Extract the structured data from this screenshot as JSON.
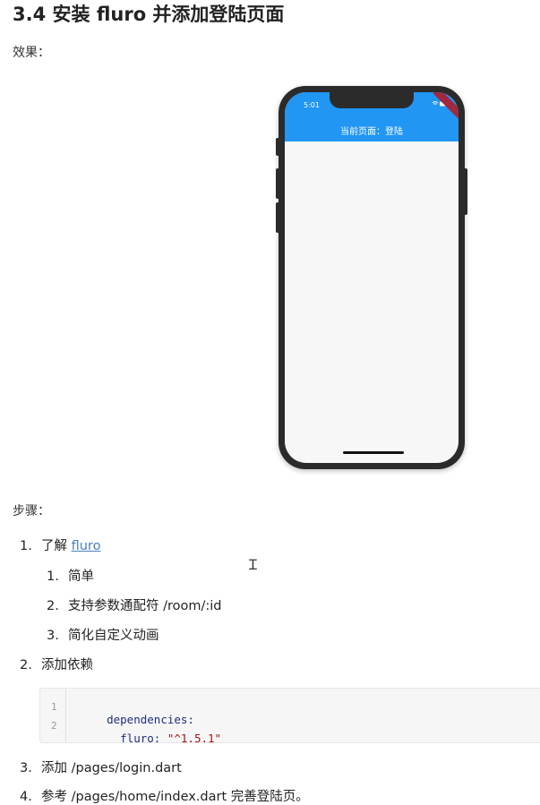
{
  "heading": "3.4 安装 fluro 并添加登陆页面",
  "effect_label": "效果：",
  "phone": {
    "status_time": "5:01",
    "appbar_title": "当前页面：登陆"
  },
  "steps_label": "步骤：",
  "steps": [
    {
      "num": "1.",
      "text": "了解 ",
      "link": "fluro",
      "sub": [
        {
          "num": "1.",
          "text": "简单"
        },
        {
          "num": "2.",
          "text": "支持参数通配符 /room/:id"
        },
        {
          "num": "3.",
          "text": "简化自定义动画"
        }
      ]
    },
    {
      "num": "2.",
      "text": "添加依赖"
    },
    {
      "num": "3.",
      "text": "添加 /pages/login.dart"
    },
    {
      "num": "4.",
      "text": "参考 /pages/home/index.dart 完善登陆页。"
    }
  ],
  "code": {
    "line_numbers": [
      "1",
      "2"
    ],
    "line1_key": "dependencies:",
    "line2_key": "  fluro: ",
    "line2_value": "\"^1.5.1\""
  }
}
